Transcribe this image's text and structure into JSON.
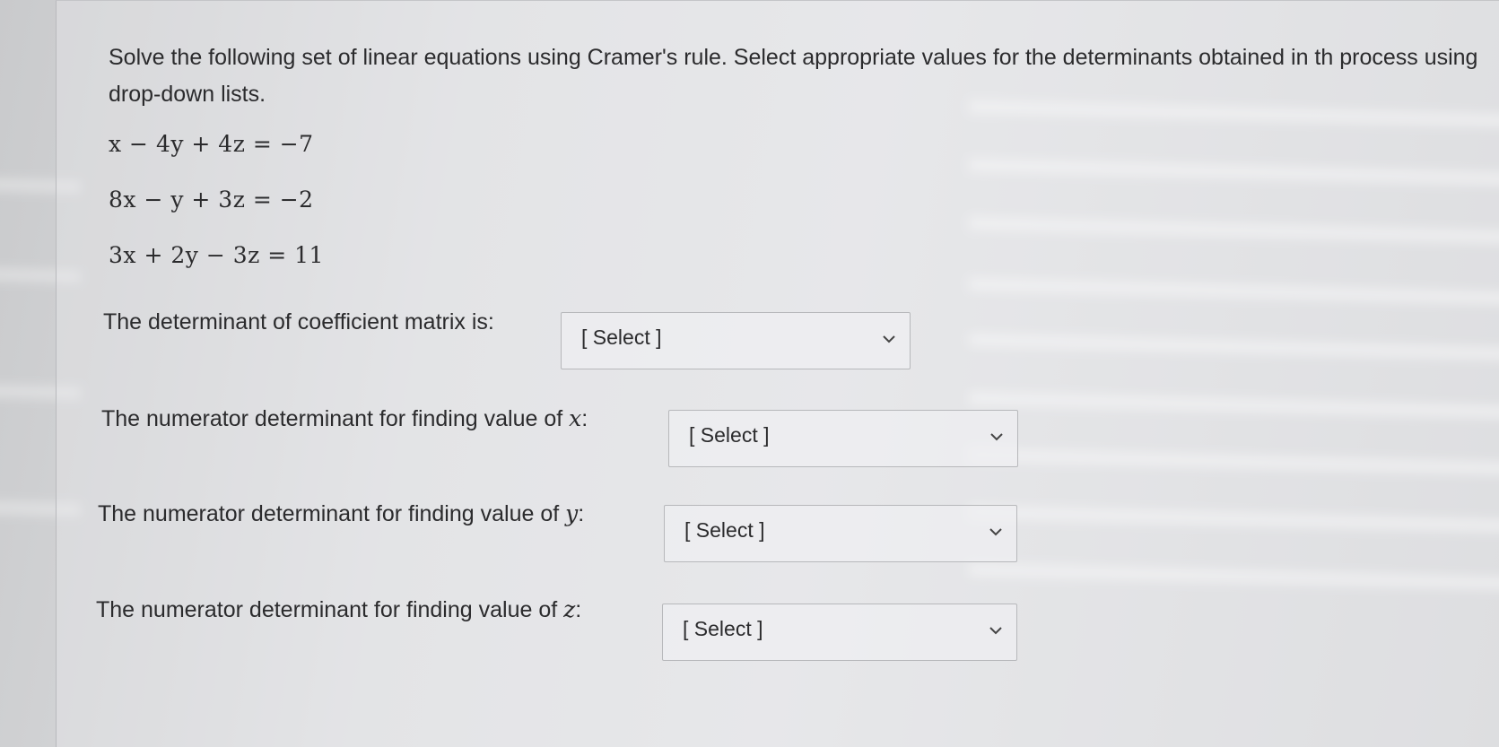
{
  "instructions": "Solve the following set of linear equations using Cramer's rule. Select appropriate values for the determinants obtained in th process using drop-down lists.",
  "equations": [
    "x − 4y + 4z = −7",
    "8x − y + 3z = −2",
    "3x + 2y − 3z = 11"
  ],
  "questions": [
    {
      "label": "The determinant of coefficient matrix is:",
      "var": "",
      "selected": "[ Select ]"
    },
    {
      "label": "The numerator determinant for finding value of ",
      "var": "x",
      "suffix": ":",
      "selected": "[ Select ]"
    },
    {
      "label": "The numerator determinant for finding value of ",
      "var": "y",
      "suffix": ":",
      "selected": "[ Select ]"
    },
    {
      "label": "The numerator determinant for finding value of ",
      "var": "z",
      "suffix": ":",
      "selected": "[ Select ]"
    }
  ],
  "icons": {
    "dropdown": "chevron-down-icon"
  },
  "colors": {
    "text": "#2b2b2d",
    "border": "#b7b8bb"
  }
}
